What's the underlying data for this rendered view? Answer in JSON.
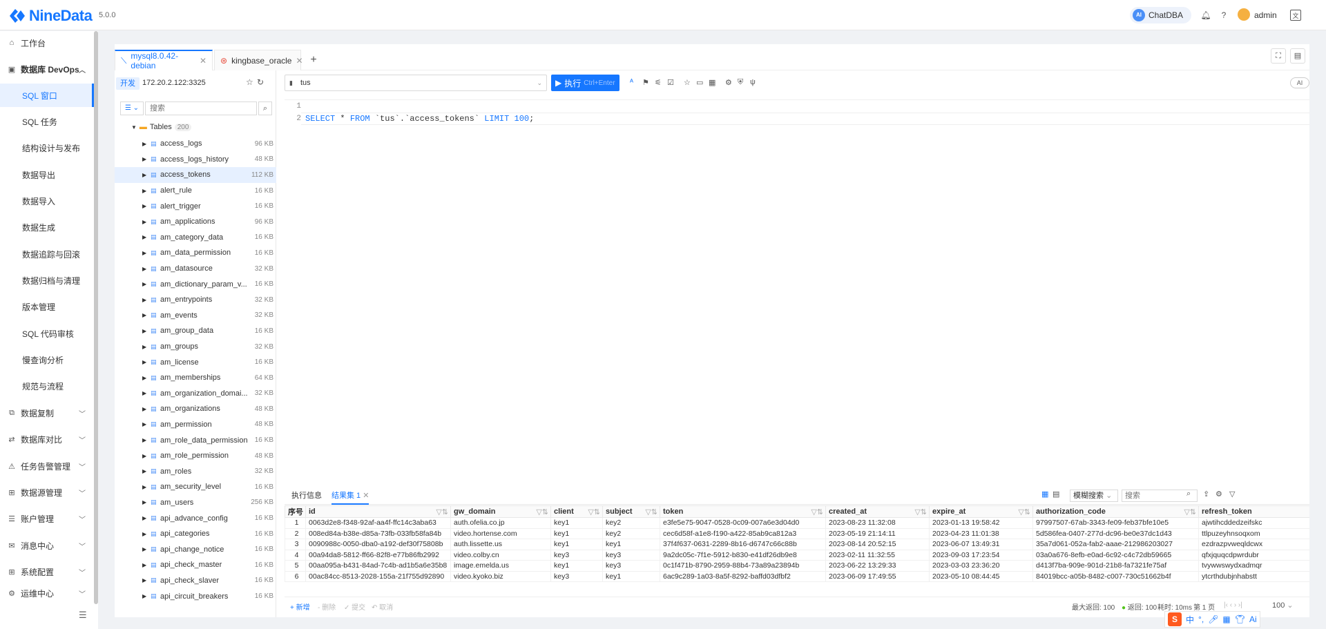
{
  "app": {
    "name": "NineData",
    "version": "5.0.0"
  },
  "topbar": {
    "chatdba": "ChatDBA",
    "ai_badge": "AI",
    "user": "admin"
  },
  "sidebar": {
    "workbench": "工作台",
    "devops": "数据库 DevOps",
    "sub": [
      "SQL 窗口",
      "SQL 任务",
      "结构设计与发布",
      "数据导出",
      "数据导入",
      "数据生成",
      "数据追踪与回滚",
      "数据归档与清理",
      "版本管理",
      "SQL 代码审核",
      "慢查询分析",
      "规范与流程"
    ],
    "groups": [
      "数据复制",
      "数据库对比",
      "任务告警管理",
      "数据源管理",
      "账户管理",
      "消息中心",
      "系统配置",
      "运维中心"
    ]
  },
  "tabs": [
    {
      "label": "mysql8.0.42-debian"
    },
    {
      "label": "kingbase_oracle"
    }
  ],
  "connection": {
    "env": "开发",
    "host": "172.20.2.122:3325",
    "search_placeholder": "搜索"
  },
  "tree": {
    "root": "Tables",
    "root_count": "200",
    "items": [
      {
        "name": "access_logs",
        "size": "96 KB"
      },
      {
        "name": "access_logs_history",
        "size": "48 KB"
      },
      {
        "name": "access_tokens",
        "size": "112 KB"
      },
      {
        "name": "alert_rule",
        "size": "16 KB"
      },
      {
        "name": "alert_trigger",
        "size": "16 KB"
      },
      {
        "name": "am_applications",
        "size": "96 KB"
      },
      {
        "name": "am_category_data",
        "size": "16 KB"
      },
      {
        "name": "am_data_permission",
        "size": "16 KB"
      },
      {
        "name": "am_datasource",
        "size": "32 KB"
      },
      {
        "name": "am_dictionary_param_v...",
        "size": "16 KB"
      },
      {
        "name": "am_entrypoints",
        "size": "32 KB"
      },
      {
        "name": "am_events",
        "size": "32 KB"
      },
      {
        "name": "am_group_data",
        "size": "16 KB"
      },
      {
        "name": "am_groups",
        "size": "32 KB"
      },
      {
        "name": "am_license",
        "size": "16 KB"
      },
      {
        "name": "am_memberships",
        "size": "64 KB"
      },
      {
        "name": "am_organization_domai...",
        "size": "32 KB"
      },
      {
        "name": "am_organizations",
        "size": "48 KB"
      },
      {
        "name": "am_permission",
        "size": "48 KB"
      },
      {
        "name": "am_role_data_permission",
        "size": "16 KB"
      },
      {
        "name": "am_role_permission",
        "size": "48 KB"
      },
      {
        "name": "am_roles",
        "size": "32 KB"
      },
      {
        "name": "am_security_level",
        "size": "16 KB"
      },
      {
        "name": "am_users",
        "size": "256 KB"
      },
      {
        "name": "api_advance_config",
        "size": "16 KB"
      },
      {
        "name": "api_categories",
        "size": "16 KB"
      },
      {
        "name": "api_change_notice",
        "size": "16 KB"
      },
      {
        "name": "api_check_master",
        "size": "16 KB"
      },
      {
        "name": "api_check_slaver",
        "size": "16 KB"
      },
      {
        "name": "api_circuit_breakers",
        "size": "16 KB"
      }
    ]
  },
  "editor": {
    "database": "tus",
    "run_label": "执行",
    "run_shortcut": "Ctrl+Enter",
    "ai_toggle": "AI",
    "lines": [
      "1",
      "2"
    ]
  },
  "results": {
    "tab_info": "执行信息",
    "tab_result": "结果集 1",
    "fuzzy": "模糊搜索",
    "search_placeholder": "搜索",
    "columns": [
      "序号",
      "id",
      "gw_domain",
      "client",
      "subject",
      "token",
      "created_at",
      "expire_at",
      "authorization_code",
      "refresh_token"
    ],
    "rows": [
      [
        "1",
        "0063d2e8-f348-92af-aa4f-ffc14c3aba63",
        "auth.ofelia.co.jp",
        "key1",
        "key2",
        "e3fe5e75-9047-0528-0c09-007a6e3d04d0",
        "2023-08-23 11:32:08",
        "2023-01-13 19:58:42",
        "97997507-67ab-3343-fe09-feb37bfe10e5",
        "ajwtihcddedzeifskc"
      ],
      [
        "2",
        "008ed84a-b38e-d85a-73fb-033fb58fa84b",
        "video.hortense.com",
        "key1",
        "key2",
        "cec6d58f-a1e8-f190-a422-85ab9ca812a3",
        "2023-05-19 21:14:11",
        "2023-04-23 11:01:38",
        "5d586fea-0407-277d-dc96-be0e37dc1d43",
        "ttlpuzeyhnsoqxom"
      ],
      [
        "3",
        "0090988c-0050-dba0-a192-def30f75808b",
        "auth.lissette.us",
        "key1",
        "key1",
        "37f4f637-0631-2289-8b16-d6747c66c88b",
        "2023-08-14 20:52:15",
        "2023-06-07 13:49:31",
        "35a7d061-052a-fab2-aaae-212986203027",
        "ezdrazpvweqldcwx"
      ],
      [
        "4",
        "00a94da8-5812-ff66-82f8-e77b86fb2992",
        "video.colby.cn",
        "key3",
        "key3",
        "9a2dc05c-7f1e-5912-b830-e41df26db9e8",
        "2023-02-11 11:32:55",
        "2023-09-03 17:23:54",
        "03a0a676-8efb-e0ad-6c92-c4c72db59665",
        "qfxjquqcdpwrdubr"
      ],
      [
        "5",
        "00aa095a-b431-84ad-7c4b-ad1b5a6e35b8",
        "image.emelda.us",
        "key1",
        "key3",
        "0c1f471b-8790-2959-88b4-73a89a23894b",
        "2023-06-22 13:29:33",
        "2023-03-03 23:36:20",
        "d413f7ba-909e-901d-21b8-fa7321fe75af",
        "tvywwswydxadmqr"
      ],
      [
        "6",
        "00ac84cc-8513-2028-155a-21f755d92890",
        "video.kyoko.biz",
        "key3",
        "key1",
        "6ac9c289-1a03-8a5f-8292-baffd03dfbf2",
        "2023-06-09 17:49:55",
        "2023-05-10 08:44:45",
        "84019bcc-a05b-8482-c007-730c51662b4f",
        "ytcrthdubjnhabstt"
      ]
    ]
  },
  "footer": {
    "add": "新增",
    "delete": "删除",
    "submit": "提交",
    "cancel": "取消",
    "max_return": "最大返回: 100",
    "returned": "返回: 100",
    "elapsed": "耗时: 10ms",
    "page": "第 1 页",
    "page_size": "100"
  },
  "ime": {
    "label": "中"
  }
}
